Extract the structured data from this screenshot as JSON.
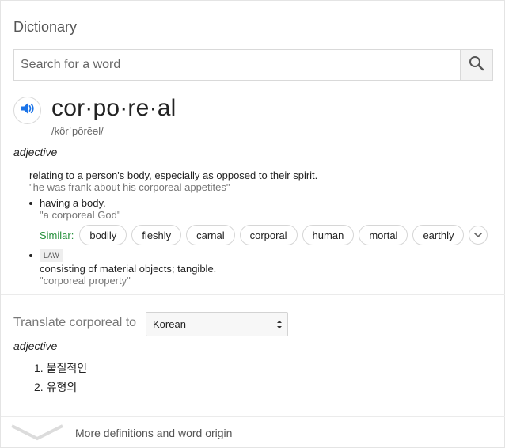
{
  "title": "Dictionary",
  "search": {
    "placeholder": "Search for a word",
    "value": ""
  },
  "entry": {
    "headword": "cor·po·re·al",
    "phonetic": "/kôrˈpôrēəl/",
    "pos": "adjective",
    "definition": "relating to a person's body, especially as opposed to their spirit.",
    "example": "\"he was frank about his corporeal appetites\"",
    "senses": [
      {
        "definition": "having a body.",
        "example": "\"a corporeal God\""
      },
      {
        "tag": "LAW",
        "definition": "consisting of material objects; tangible.",
        "example": "\"corporeal property\""
      }
    ],
    "similar_label": "Similar:",
    "similar": [
      "bodily",
      "fleshly",
      "carnal",
      "corporal",
      "human",
      "mortal",
      "earthly"
    ]
  },
  "translate": {
    "label": "Translate corporeal to",
    "language": "Korean",
    "pos": "adjective",
    "items": [
      "1. 물질적인",
      "2. 유형의"
    ]
  },
  "more": {
    "label": "More definitions and word origin"
  },
  "icons": {
    "search": "search-icon",
    "speaker": "speaker-icon",
    "expand": "chevron-down-icon",
    "more": "chevron-down-icon",
    "select": "select-arrows-icon"
  },
  "colors": {
    "accent": "#1a73e8",
    "similar_label": "#26913c",
    "muted": "#777777"
  }
}
